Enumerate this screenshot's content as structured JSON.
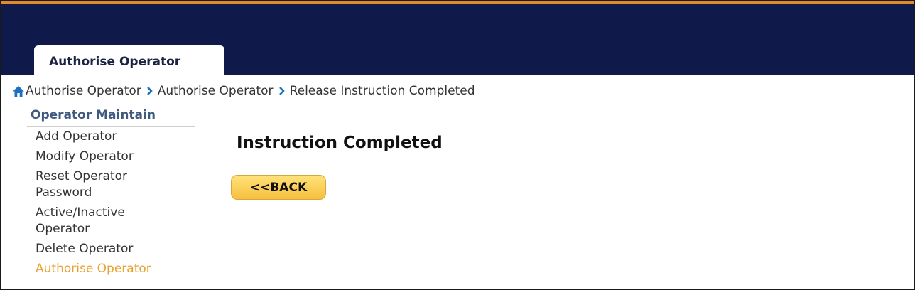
{
  "tab": {
    "label": "Authorise Operator"
  },
  "breadcrumb": {
    "items": [
      "Authorise Operator",
      "Authorise Operator",
      "Release Instruction Completed"
    ]
  },
  "sidebar": {
    "title": "Operator Maintain",
    "items": [
      {
        "label": "Add Operator"
      },
      {
        "label": "Modify Operator"
      },
      {
        "label": "Reset Operator Password"
      },
      {
        "label": "Active/Inactive Operator"
      },
      {
        "label": "Delete Operator"
      },
      {
        "label": "Authorise Operator"
      }
    ]
  },
  "main": {
    "title": "Instruction Completed",
    "back_label": "<<BACK"
  },
  "colors": {
    "header_bg": "#101a4a",
    "header_accent": "#e08a2c",
    "link_blue": "#1d6fc0",
    "sidebar_title": "#3f5a80",
    "active_item": "#e8a12e",
    "button_bg": "#f7c03d"
  }
}
